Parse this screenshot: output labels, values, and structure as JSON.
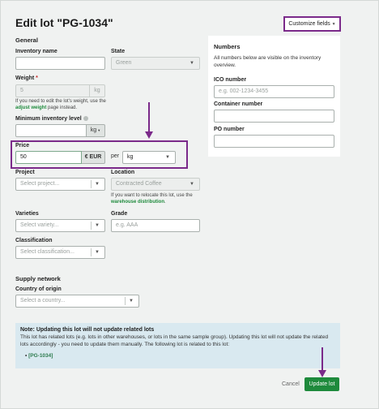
{
  "page": {
    "title": "Edit lot \"PG-1034\"",
    "customize_fields_label": "Customize fields"
  },
  "general": {
    "heading": "General",
    "inventory_name": {
      "label": "Inventory name",
      "value": ""
    },
    "state": {
      "label": "State",
      "value": "Green"
    },
    "weight": {
      "label": "Weight",
      "required_mark": "*",
      "value": "5",
      "unit": "kg",
      "help_prefix": "If you need to edit the lot's weight, use the",
      "help_link": "adjust weight",
      "help_suffix": "page instead."
    },
    "min_inventory": {
      "label": "Minimum inventory level",
      "value": "",
      "unit": "kg"
    },
    "price": {
      "label": "Price",
      "value": "50",
      "currency": "€ EUR",
      "per_label": "per",
      "per_unit": "kg"
    },
    "project": {
      "label": "Project",
      "placeholder": "Select project..."
    },
    "location": {
      "label": "Location",
      "value": "Contracted Coffee",
      "help_prefix": "If you want to relocate this lot, use the",
      "help_link": "warehouse distribution",
      "help_suffix": "."
    },
    "varieties": {
      "label": "Varieties",
      "placeholder": "Select variety..."
    },
    "grade": {
      "label": "Grade",
      "placeholder": "e.g. AAA"
    },
    "classification": {
      "label": "Classification",
      "placeholder": "Select classification..."
    }
  },
  "supply": {
    "heading": "Supply network",
    "country": {
      "label": "Country of origin",
      "placeholder": "Select a country..."
    }
  },
  "numbers": {
    "heading": "Numbers",
    "description": "All numbers below are visible on the inventory overview.",
    "ico": {
      "label": "ICO number",
      "placeholder": "e.g. 002-1234-3455"
    },
    "container": {
      "label": "Container number",
      "value": ""
    },
    "po": {
      "label": "PO number",
      "value": ""
    }
  },
  "note": {
    "title": "Note: Updating this lot will not update related lots",
    "body": "This lot has related lots (e.g. lots in other warehouses, or lots in the same sample group). Updating this lot will not update the related lots accordingly - you need to update them manually. The following lot is related to this lot:",
    "related": [
      "[PG-1034]"
    ]
  },
  "actions": {
    "cancel": "Cancel",
    "update": "Update lot"
  },
  "colors": {
    "accent": "#1e8a3c",
    "highlight": "#7b2a8a",
    "note_bg": "#d9e9f0"
  }
}
